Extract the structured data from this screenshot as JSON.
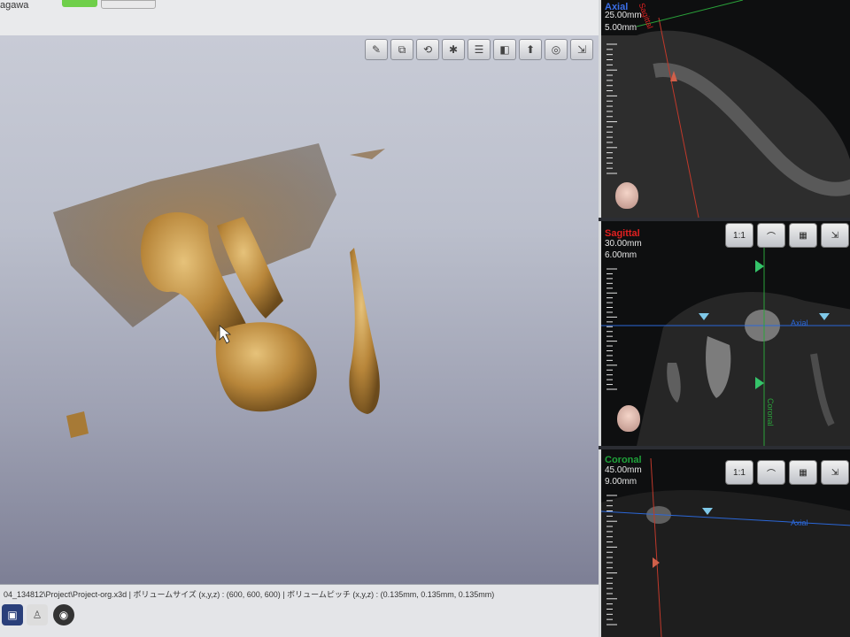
{
  "topbar": {
    "user": "agawa"
  },
  "toolbar3d": {
    "buttons": [
      {
        "icon": "pen-icon",
        "glyph": "✎"
      },
      {
        "icon": "volume-icon",
        "glyph": "⧉"
      },
      {
        "icon": "cube-rotate-icon",
        "glyph": "⟲"
      },
      {
        "icon": "gear-icon",
        "glyph": "✱"
      },
      {
        "icon": "layers-icon",
        "glyph": "☰"
      },
      {
        "icon": "cube-icon",
        "glyph": "◧"
      },
      {
        "icon": "tooth-icon",
        "glyph": "⬆"
      },
      {
        "icon": "scan-icon",
        "glyph": "◎"
      },
      {
        "icon": "export-icon",
        "glyph": "⇲"
      }
    ]
  },
  "panels": {
    "axial": {
      "label": "Axial",
      "zoom": "25.00mm",
      "slice": "5.00mm"
    },
    "sagittal": {
      "label": "Sagittal",
      "zoom": "30.00mm",
      "slice": "6.00mm",
      "btn_zoom": "1:1"
    },
    "coronal": {
      "label": "Coronal",
      "zoom": "45.00mm",
      "slice": "9.00mm",
      "btn_zoom": "1:1"
    },
    "tags": {
      "axial": "Axial",
      "coronal": "Coronal",
      "sagittal": "Sagittal"
    }
  },
  "statusbar": {
    "path": "04_134812\\Project\\Project-org.x3d",
    "volume_size": "ボリュームサイズ (x,y,z) : (600, 600, 600)",
    "volume_pitch": "ボリュームピッチ (x,y,z) : (0.135mm, 0.135mm, 0.135mm)"
  },
  "colors": {
    "axial": "#1f5fd6",
    "sagittal": "#e02020",
    "coronal": "#1fa23a",
    "bone": "#b8863a"
  }
}
